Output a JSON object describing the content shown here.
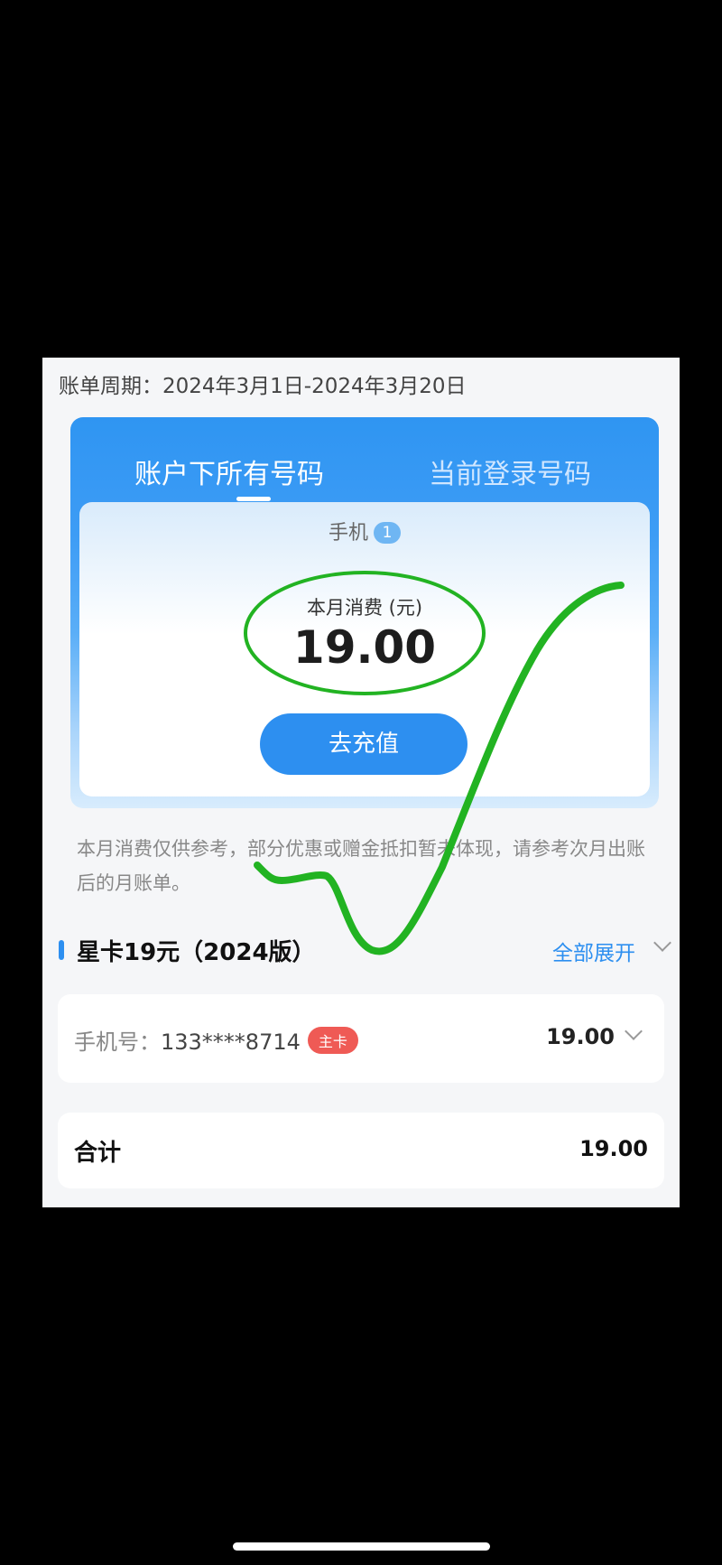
{
  "billing": {
    "period": "账单周期：2024年3月1日-2024年3月20日"
  },
  "tabs": {
    "all_numbers": "账户下所有号码",
    "current_number": "当前登录号码"
  },
  "summary": {
    "phone_label": "手机",
    "phone_count": "1",
    "spend_label": "本月消费 (元)",
    "spend_value": "19.00",
    "recharge_button": "去充值"
  },
  "note": "本月消费仅供参考，部分优惠或赠金抵扣暂未体现，请参考次月出账后的月账单。",
  "plan": {
    "title": "星卡19元（2024版）",
    "expand_label": "全部展开"
  },
  "phone_row": {
    "prefix": "手机号：",
    "number": "133****8714",
    "badge": "主卡",
    "amount": "19.00"
  },
  "total": {
    "label": "合计",
    "amount": "19.00"
  },
  "colors": {
    "accent": "#2d8ff0",
    "badge": "#ef5a55",
    "annotation": "#22b322"
  }
}
